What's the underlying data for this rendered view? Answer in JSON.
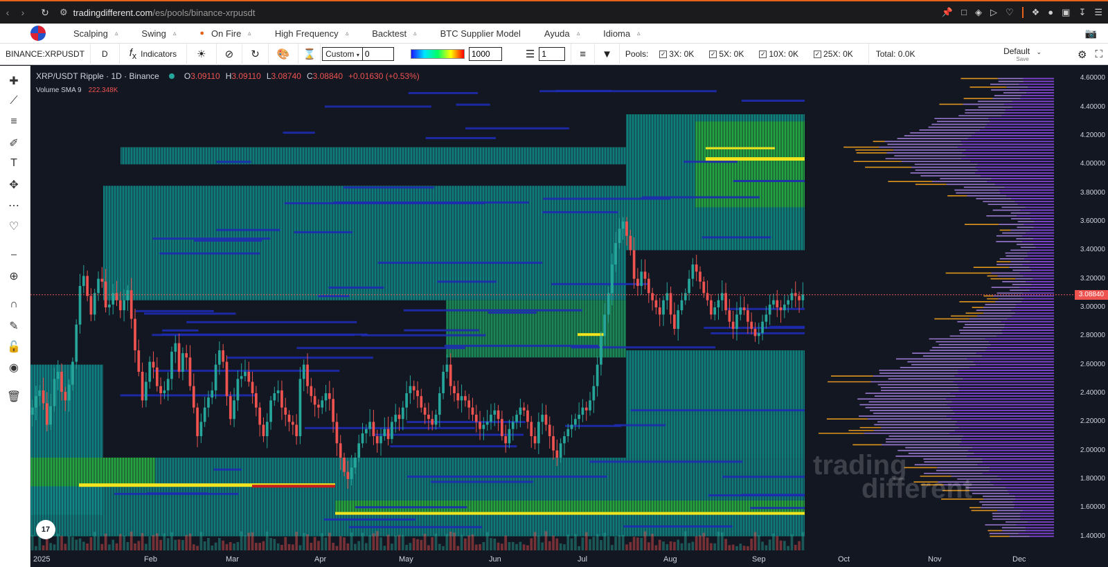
{
  "browser": {
    "url_host": "tradingdifferent.com",
    "url_path": "/es/pools/binance-xrpusdt",
    "accent": "#e8611a"
  },
  "menu": {
    "items": [
      {
        "label": "Scalping",
        "icon": ""
      },
      {
        "label": "Swing",
        "icon": ""
      },
      {
        "label": "On Fire",
        "icon": "fire-icon"
      },
      {
        "label": "High Frequency",
        "icon": ""
      },
      {
        "label": "Backtest",
        "icon": ""
      },
      {
        "label": "BTC Supplier Model",
        "icon": ""
      },
      {
        "label": "Ayuda",
        "icon": ""
      },
      {
        "label": "Idioma",
        "icon": ""
      }
    ]
  },
  "toolbar": {
    "symbol": "BINANCE:XRPUSDT",
    "interval": "D",
    "indicators": "Indicators",
    "mode": "Custom",
    "mode_value": "0",
    "threshold": "1000",
    "layers": "1",
    "pools_label": "Pools:",
    "pools": [
      {
        "label": "3X: 0K",
        "checked": true
      },
      {
        "label": "5X: 0K",
        "checked": true
      },
      {
        "label": "10X: 0K",
        "checked": true
      },
      {
        "label": "25X: 0K",
        "checked": true
      }
    ],
    "total": "Total: 0.0K",
    "layout": "Default",
    "layout_sub": "Save"
  },
  "legend": {
    "title": "XRP/USDT Ripple · 1D · Binance",
    "o_label": "O",
    "o": "3.09110",
    "h_label": "H",
    "h": "3.09110",
    "l_label": "L",
    "l": "3.08740",
    "c_label": "C",
    "c": "3.08840",
    "change": "+0.01630 (+0.53%)",
    "vol_label": "Volume SMA 9",
    "vol_value": "222.348K"
  },
  "chart_data": {
    "type": "candlestick",
    "current_price": "3.08840",
    "price_ticks": [
      "4.60000",
      "4.40000",
      "4.20000",
      "4.00000",
      "3.80000",
      "3.60000",
      "3.40000",
      "3.20000",
      "3.00000",
      "2.80000",
      "2.60000",
      "2.40000",
      "2.20000",
      "2.00000",
      "1.80000",
      "1.60000",
      "1.40000"
    ],
    "ylim": [
      1.35,
      4.66
    ],
    "time_ticks": [
      "2025",
      "Feb",
      "Mar",
      "Apr",
      "May",
      "Jun",
      "Jul",
      "Aug",
      "Sep",
      "Oct",
      "Nov",
      "Dec"
    ],
    "closes_daily": [
      2.3,
      2.38,
      2.42,
      2.33,
      2.18,
      2.31,
      2.5,
      2.55,
      2.41,
      2.35,
      2.46,
      2.62,
      2.88,
      3.15,
      3.22,
      3.08,
      2.95,
      3.1,
      3.2,
      3.18,
      3.0,
      3.02,
      3.1,
      3.05,
      2.98,
      3.05,
      3.12,
      2.92,
      2.7,
      2.55,
      2.35,
      2.48,
      2.62,
      2.58,
      2.45,
      2.4,
      2.42,
      2.5,
      2.69,
      2.75,
      2.55,
      2.68,
      2.65,
      2.45,
      2.3,
      2.1,
      2.2,
      2.3,
      2.37,
      2.42,
      2.6,
      2.7,
      2.62,
      2.38,
      2.22,
      2.35,
      2.5,
      2.52,
      2.55,
      2.48,
      2.4,
      2.3,
      2.18,
      2.1,
      2.2,
      2.35,
      2.4,
      2.42,
      2.3,
      2.25,
      2.2,
      2.18,
      2.1,
      2.5,
      2.6,
      2.45,
      2.38,
      2.32,
      2.3,
      2.35,
      2.4,
      2.36,
      2.2,
      2.05,
      1.95,
      1.85,
      1.8,
      1.88,
      1.95,
      2.05,
      2.12,
      2.15,
      2.2,
      2.1,
      2.05,
      2.1,
      2.15,
      2.08,
      2.2,
      2.25,
      2.22,
      2.3,
      2.4,
      2.45,
      2.42,
      2.38,
      2.3,
      2.25,
      2.22,
      2.18,
      2.25,
      2.4,
      2.55,
      2.6,
      2.45,
      2.4,
      2.35,
      2.38,
      2.35,
      2.3,
      2.25,
      2.2,
      2.15,
      2.18,
      2.2,
      2.25,
      2.28,
      2.22,
      2.1,
      2.05,
      2.15,
      2.2,
      2.25,
      2.3,
      2.28,
      2.2,
      2.1,
      2.05,
      2.2,
      2.25,
      2.18,
      2.1,
      2.0,
      1.95,
      2.05,
      2.1,
      2.15,
      2.18,
      2.22,
      2.25,
      2.3,
      2.28,
      2.35,
      2.45,
      2.6,
      2.8,
      2.95,
      3.1,
      3.3,
      3.45,
      3.55,
      3.6,
      3.5,
      3.4,
      3.2,
      3.15,
      3.25,
      3.2,
      3.1,
      3.05,
      3.0,
      2.95,
      3.05,
      3.1,
      2.95,
      2.85,
      2.98,
      3.05,
      3.1,
      3.2,
      3.3,
      3.25,
      3.18,
      3.1,
      3.05,
      2.95,
      3.0,
      3.05,
      3.1,
      2.98,
      2.9,
      2.85,
      2.95,
      3.0,
      2.98,
      2.9,
      2.85,
      2.8,
      2.82,
      2.9,
      2.95,
      3.02,
      3.05,
      3.0,
      2.98,
      3.02,
      3.05,
      3.1,
      3.08,
      3.05,
      3.09
    ]
  },
  "watermark": [
    "trading",
    "different"
  ],
  "tv_badge": "17"
}
